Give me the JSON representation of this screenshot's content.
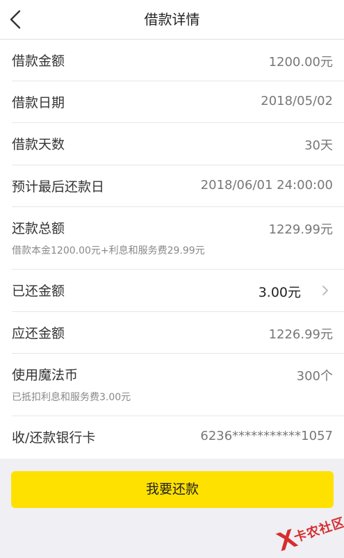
{
  "header": {
    "title": "借款详情",
    "back_icon": "chevron-left-icon"
  },
  "rows": [
    {
      "label": "借款金额",
      "value": "1200.00元"
    },
    {
      "label": "借款日期",
      "value": "2018/05/02"
    },
    {
      "label": "借款天数",
      "value": "30天"
    },
    {
      "label": "预计最后还款日",
      "value": "2018/06/01 24:00:00"
    },
    {
      "label": "还款总额",
      "value": "1229.99元",
      "sub": "借款本金1200.00元+利息和服务费29.99元"
    },
    {
      "label": "已还金额",
      "value": "3.00元"
    },
    {
      "label": "应还金额",
      "value": "1226.99元"
    },
    {
      "label": "使用魔法币",
      "value": "300个",
      "sub": "已抵扣利息和服务费3.00元"
    },
    {
      "label": "收/还款银行卡",
      "value": "6236***********1057"
    }
  ],
  "button": {
    "label": "我要还款",
    "color": "#ffe100"
  },
  "watermark": {
    "text": "卡农社区"
  },
  "colors": {
    "background": "#efeff4",
    "accent": "#ffe100"
  }
}
